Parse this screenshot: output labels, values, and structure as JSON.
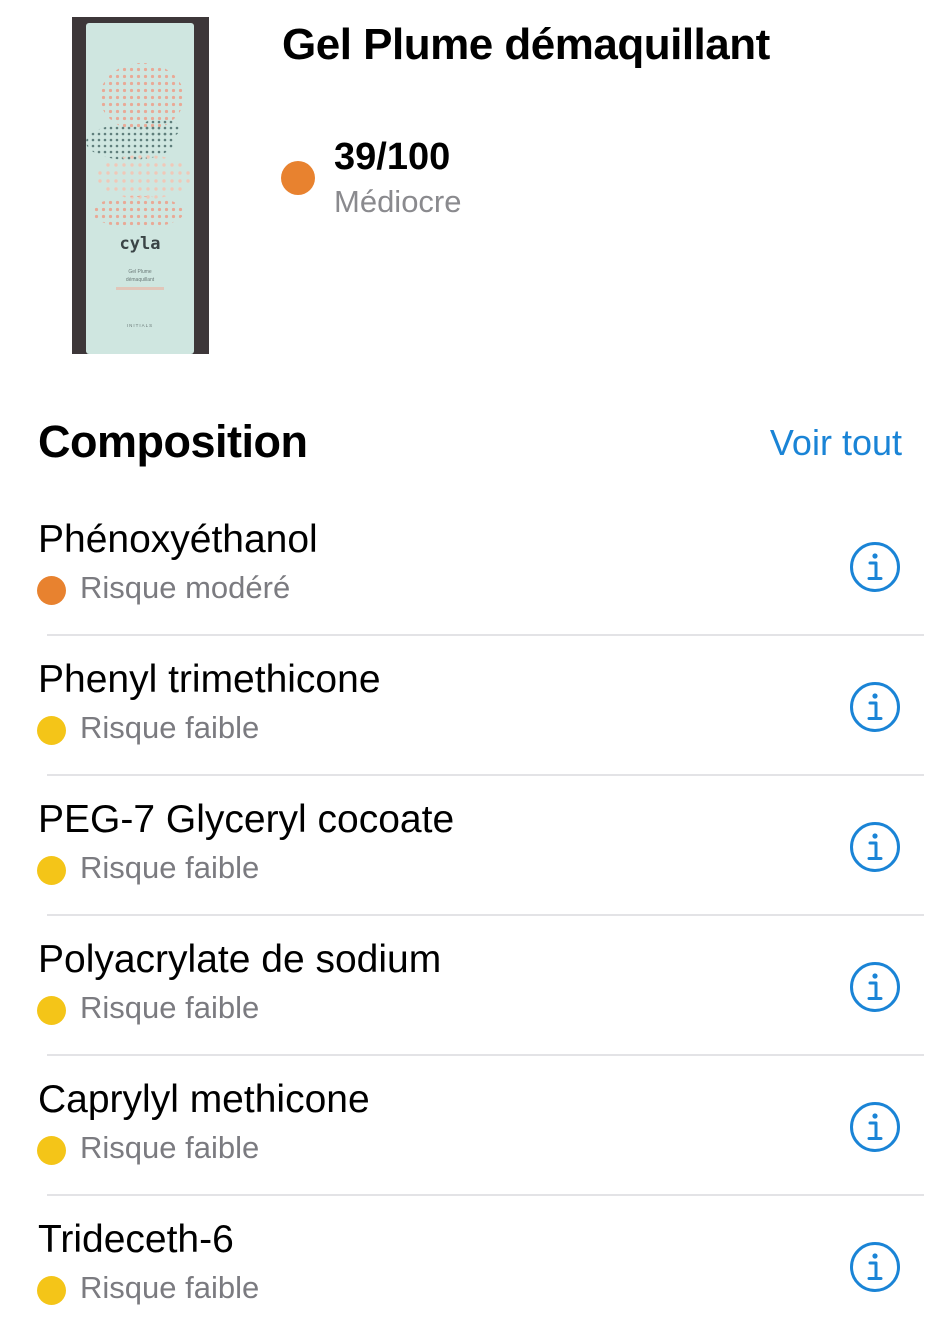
{
  "product": {
    "title": "Gel Plume démaquillant",
    "image_icon": "product-photo",
    "image_text": {
      "brand": "cyla",
      "line1": "Gel Plume",
      "line2": "démaquillant",
      "footer": "INITIALS"
    },
    "score": "39/100",
    "score_label": "Médiocre",
    "score_color": "#e8822f"
  },
  "composition": {
    "title": "Composition",
    "see_all_label": "Voir tout",
    "accent_color": "#1a84d6",
    "info_icon": "info-circle-icon",
    "items": [
      {
        "name": "Phénoxyéthanol",
        "risk": "Risque modéré",
        "risk_color": "#e8822f"
      },
      {
        "name": "Phenyl trimethicone",
        "risk": "Risque faible",
        "risk_color": "#f4c518"
      },
      {
        "name": "PEG-7 Glyceryl cocoate",
        "risk": "Risque faible",
        "risk_color": "#f4c518"
      },
      {
        "name": "Polyacrylate de sodium",
        "risk": "Risque faible",
        "risk_color": "#f4c518"
      },
      {
        "name": "Caprylyl methicone",
        "risk": "Risque faible",
        "risk_color": "#f4c518"
      },
      {
        "name": "Trideceth-6",
        "risk": "Risque faible",
        "risk_color": "#f4c518"
      }
    ]
  }
}
